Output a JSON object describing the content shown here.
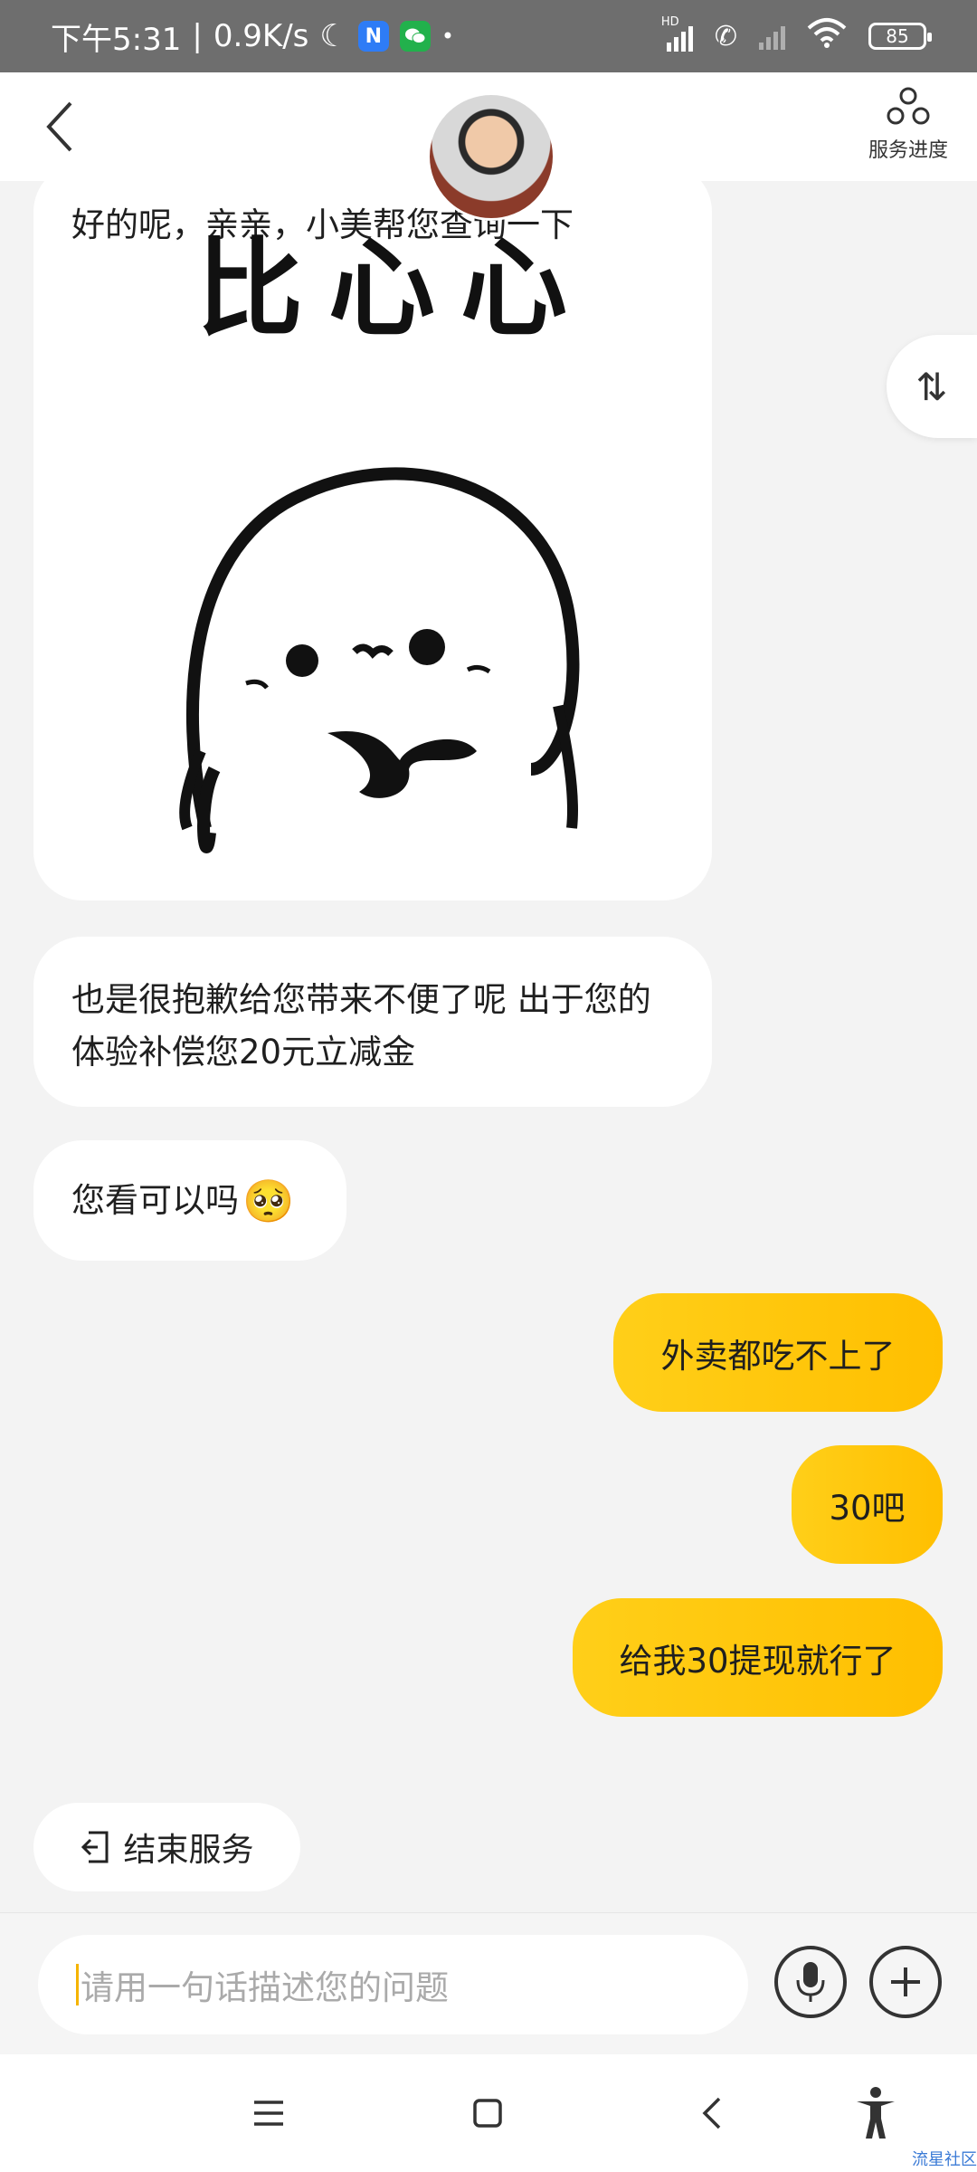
{
  "status_bar": {
    "time": "下午5:31",
    "separator": "|",
    "speed": "0.9K/s",
    "app_icon_n": "N",
    "battery": "85",
    "network": "HD"
  },
  "header": {
    "service_progress_label": "服务进度"
  },
  "messages": [
    {
      "side": "left",
      "text": "好的呢，亲亲，小美帮您查询一下",
      "sticker_text": "比心心"
    },
    {
      "side": "left",
      "text": "也是很抱歉给您带来不便了呢 出于您的体验补偿您20元立减金"
    },
    {
      "side": "left",
      "text": "您看可以吗",
      "emoji": "🥺"
    },
    {
      "side": "right",
      "text": "外卖都吃不上了"
    },
    {
      "side": "right",
      "text": "30吧"
    },
    {
      "side": "right",
      "text": "给我30提现就行了"
    }
  ],
  "end_service": {
    "label": "结束服务"
  },
  "input": {
    "placeholder": "请用一句话描述您的问题"
  },
  "toggle_symbol": "⇅",
  "watermark": "流星社区",
  "colors": {
    "accent": "#ffc107",
    "bubble_left": "#ffffff",
    "background": "#f3f3f3"
  }
}
